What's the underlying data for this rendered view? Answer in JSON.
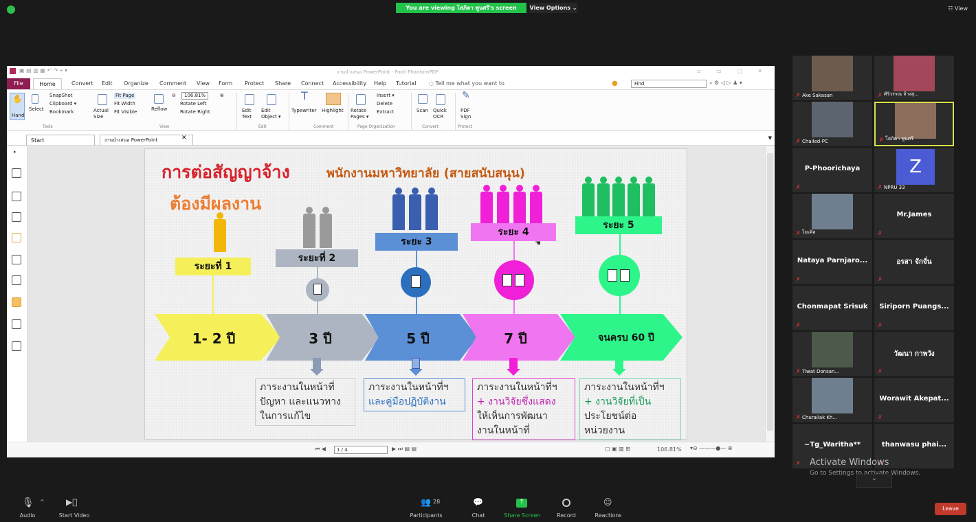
{
  "top": {
    "viewing": "You are viewing โสภิตา พูนศรี's screen",
    "view_options": "View Options ⌄",
    "view_button": "☷ View"
  },
  "app": {
    "title": "งานนำเสนอ PowerPoint - Foxit PhantomPDF",
    "menu": [
      "File",
      "Home",
      "Convert",
      "Edit",
      "Organize",
      "Comment",
      "View",
      "Form",
      "Protect",
      "Share",
      "Connect",
      "Accessibility",
      "Help",
      "Tutorial"
    ],
    "tell_me": "Tell me what you want to",
    "find": "Find",
    "ribbon": {
      "hand": "Hand",
      "select": "Select",
      "snapshot": "SnapShot",
      "clipboard": "Clipboard ▾",
      "bookmark": "Bookmark",
      "actual_size": "Actual Size",
      "fit_page": "Fit Page",
      "fit_width": "Fit Width",
      "fit_visible": "Fit Visible",
      "reflow": "Reflow",
      "zoom_value": "106.81%",
      "rotate_left": "Rotate Left",
      "rotate_right": "Rotate Right",
      "edit_text": "Edit Text",
      "edit_object": "Edit Object ▾",
      "typewriter": "Typewriter",
      "highlight": "Highlight",
      "rotate_pages": "Rotate Pages ▾",
      "insert": "Insert ▾",
      "delete": "Delete",
      "extract": "Extract",
      "scan": "Scan",
      "quick_ocr": "Quick OCR",
      "pdf_sign": "PDF Sign",
      "groups": [
        "Tools",
        "View",
        "Edit",
        "Comment",
        "Page Organization",
        "Convert",
        "Protect"
      ]
    },
    "tabs": [
      "Start",
      "งานนำเสนอ PowerPoint"
    ],
    "page": "1 / 4",
    "zoom": "106.81%"
  },
  "slide": {
    "title": "การต่อสัญญาจ้าง",
    "subtitle": "พนักงานมหาวิทยาลัย (สายสนับสนุน)",
    "subtitle2": "ต้องมีผลงาน",
    "levels": [
      "ระยะที่ 1",
      "ระยะที่ 2",
      "ระยะ 3",
      "ระยะ 4",
      "ระยะ 5"
    ],
    "years": [
      "1- 2 ปี",
      "3 ปี",
      "5 ปี",
      "7 ปี",
      "จนครบ 60 ปี"
    ],
    "descriptions": [
      [
        "ภาระงานในหน้าที่",
        "ปัญหา และแนวทาง",
        "ในการแก้ไข"
      ],
      [
        "ภาระงานในหน้าที่ฯ",
        "และคู่มือปฏิบัติงาน"
      ],
      [
        "ภาระงานในหน้าที่ฯ",
        "+ งานวิจัยซึ่งแสดง",
        "ให้เห็นการพัฒนา",
        "งานในหน้าที่"
      ],
      [
        "ภาระงานในหน้าที่ฯ",
        "+ งานวิจัยที่เป็น",
        "ประโยชน์ต่อ",
        "หน่วยงาน"
      ]
    ],
    "colors": {
      "yellow": "#f5f05a",
      "gray": "#adb5c2",
      "blue": "#5b8fd6",
      "magenta": "#f075f0",
      "green": "#2ef58a"
    }
  },
  "participants": [
    {
      "name": "Ake Sakasan",
      "video": true
    },
    {
      "name": "ศิริวรรณ จ้างสุ...",
      "video": true
    },
    {
      "name": "Chailed-PC",
      "video": true
    },
    {
      "name": "โสภิตา พูนศรี",
      "video": true
    },
    {
      "name": "P-Phoorichaya",
      "video": false
    },
    {
      "name": "NPRU 33",
      "video": false,
      "avatar": "Z"
    },
    {
      "name": "ไมเคิล",
      "video": true
    },
    {
      "name": "Mr.James",
      "video": false
    },
    {
      "name": "Nataya Parnjaro...",
      "video": false
    },
    {
      "name": "อรสา จักจั่น",
      "video": false
    },
    {
      "name": "Chonmapat Srisuk",
      "video": false
    },
    {
      "name": "Siriporn Puangs...",
      "video": false
    },
    {
      "name": "Tiwat Donsan...",
      "video": true
    },
    {
      "name": "วัฒนา กาพวัง",
      "video": false
    },
    {
      "name": "Churailak Kh...",
      "video": true
    },
    {
      "name": "Worawit Akepat...",
      "video": false
    },
    {
      "name": "~Tg_Waritha**",
      "video": false
    },
    {
      "name": "thanwasu phai...",
      "video": false
    }
  ],
  "activate": {
    "title": "Activate Windows",
    "subtitle": "Go to Settings to activate Windows."
  },
  "bottom": {
    "audio": "Audio",
    "start_video": "Start Video",
    "participants_count": "28",
    "participants": "Participants",
    "chat": "Chat",
    "share_screen": "Share Screen",
    "record": "Record",
    "reactions": "Reactions",
    "leave": "Leave"
  }
}
